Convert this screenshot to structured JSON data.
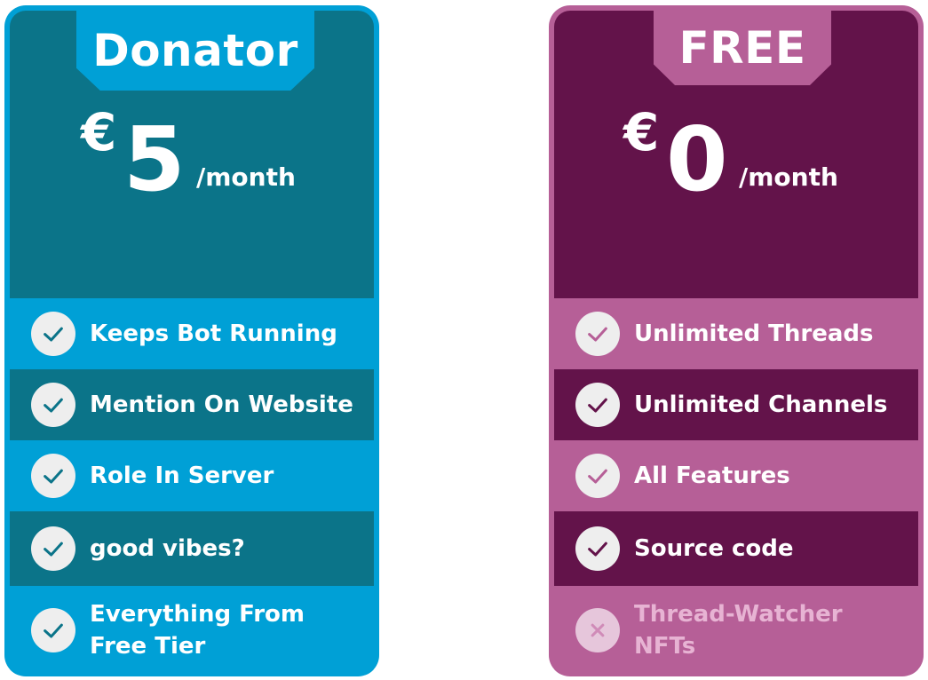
{
  "cards": {
    "donator": {
      "title": "Donator",
      "currency": "€",
      "amount": "5",
      "period": "/month",
      "features": [
        {
          "label": "Keeps Bot Running",
          "icon": "check-icon"
        },
        {
          "label": "Mention On Website",
          "icon": "check-icon"
        },
        {
          "label": "Role In Server",
          "icon": "check-icon"
        },
        {
          "label": "good vibes?",
          "icon": "check-icon"
        },
        {
          "label": "Everything From Free Tier",
          "icon": "check-icon"
        }
      ]
    },
    "free": {
      "title": "FREE",
      "currency": "€",
      "amount": "0",
      "period": "/month",
      "features": [
        {
          "label": "Unlimited Threads",
          "icon": "check-icon"
        },
        {
          "label": "Unlimited Channels",
          "icon": "check-icon"
        },
        {
          "label": "All Features",
          "icon": "check-icon"
        },
        {
          "label": "Source code",
          "icon": "check-icon"
        },
        {
          "label": "Thread-Watcher NFTs",
          "icon": "x-icon"
        }
      ]
    }
  },
  "colors": {
    "donator_light": "#00a0d6",
    "donator_dark": "#0b7489",
    "free_light": "#b65f97",
    "free_dark": "#63134a",
    "check_bg": "#eeeeee"
  }
}
